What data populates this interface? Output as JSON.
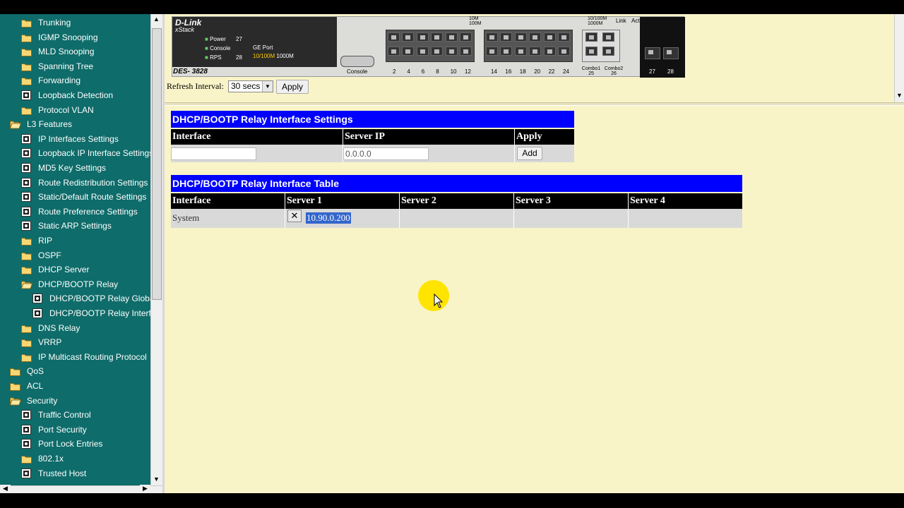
{
  "nav": {
    "items": [
      {
        "label": "Trunking",
        "icon": "folder",
        "indent": 1
      },
      {
        "label": "IGMP Snooping",
        "icon": "folder",
        "indent": 1
      },
      {
        "label": "MLD Snooping",
        "icon": "folder",
        "indent": 1
      },
      {
        "label": "Spanning Tree",
        "icon": "folder",
        "indent": 1
      },
      {
        "label": "Forwarding",
        "icon": "folder",
        "indent": 1
      },
      {
        "label": "Loopback Detection",
        "icon": "page",
        "indent": 1
      },
      {
        "label": "Protocol VLAN",
        "icon": "folder",
        "indent": 1
      },
      {
        "label": "L3 Features",
        "icon": "folder-open",
        "indent": 0
      },
      {
        "label": "IP Interfaces Settings",
        "icon": "page",
        "indent": 1
      },
      {
        "label": "Loopback IP Interface Settings",
        "icon": "page",
        "indent": 1
      },
      {
        "label": "MD5 Key Settings",
        "icon": "page",
        "indent": 1
      },
      {
        "label": "Route Redistribution Settings",
        "icon": "page",
        "indent": 1
      },
      {
        "label": "Static/Default Route Settings",
        "icon": "page",
        "indent": 1
      },
      {
        "label": "Route Preference Settings",
        "icon": "page",
        "indent": 1
      },
      {
        "label": "Static ARP Settings",
        "icon": "page",
        "indent": 1
      },
      {
        "label": "RIP",
        "icon": "folder",
        "indent": 1
      },
      {
        "label": "OSPF",
        "icon": "folder",
        "indent": 1
      },
      {
        "label": "DHCP Server",
        "icon": "folder",
        "indent": 1
      },
      {
        "label": "DHCP/BOOTP Relay",
        "icon": "folder-open",
        "indent": 1
      },
      {
        "label": "DHCP/BOOTP Relay Globa",
        "icon": "page",
        "indent": 2
      },
      {
        "label": "DHCP/BOOTP Relay Interfa",
        "icon": "page",
        "indent": 2
      },
      {
        "label": "DNS Relay",
        "icon": "folder",
        "indent": 1
      },
      {
        "label": "VRRP",
        "icon": "folder",
        "indent": 1
      },
      {
        "label": "IP Multicast Routing Protocol",
        "icon": "folder",
        "indent": 1
      },
      {
        "label": "QoS",
        "icon": "folder",
        "indent": 0
      },
      {
        "label": "ACL",
        "icon": "folder",
        "indent": 0
      },
      {
        "label": "Security",
        "icon": "folder-open",
        "indent": 0
      },
      {
        "label": "Traffic Control",
        "icon": "page",
        "indent": 1
      },
      {
        "label": "Port Security",
        "icon": "page",
        "indent": 1
      },
      {
        "label": "Port Lock Entries",
        "icon": "page",
        "indent": 1
      },
      {
        "label": "802.1x",
        "icon": "folder",
        "indent": 1
      },
      {
        "label": "Trusted Host",
        "icon": "page",
        "indent": 1
      }
    ]
  },
  "device": {
    "brand": "D-Link",
    "series": "xStack",
    "model": "DES- 3828",
    "leds": {
      "power": "Power",
      "console": "Console",
      "rps": "RPS",
      "p27": "27",
      "p28": "28",
      "ge_port": "GE Port",
      "speed1": "10/100M",
      "speed2": "1000M"
    },
    "top_legend": {
      "speed_a": "10M",
      "speed_b": "100M",
      "combo_a": "10/100M",
      "combo_b": "1000M",
      "link": "Link",
      "act": "Act"
    },
    "console_label": "Console",
    "port_numbers": [
      "2",
      "4",
      "6",
      "8",
      "10",
      "12",
      "14",
      "16",
      "18",
      "20",
      "22",
      "24"
    ],
    "combo_labels": [
      "Combo1",
      "Combo2"
    ],
    "combo_numbers": [
      "25",
      "26"
    ],
    "sfp_numbers": [
      "27",
      "28"
    ]
  },
  "refresh": {
    "label": "Refresh Interval:",
    "value": "30 secs",
    "apply_label": "Apply"
  },
  "settings_table": {
    "title": "DHCP/BOOTP Relay Interface Settings",
    "headers": [
      "Interface",
      "Server IP",
      "Apply"
    ],
    "interface_value": "",
    "server_ip_value": "0.0.0.0",
    "add_label": "Add"
  },
  "relay_table": {
    "title": "DHCP/BOOTP Relay Interface Table",
    "headers": [
      "Interface",
      "Server 1",
      "Server 2",
      "Server 3",
      "Server 4"
    ],
    "rows": [
      {
        "interface": "System",
        "server1": "10.90.0.200",
        "server2": "",
        "server3": "",
        "server4": ""
      }
    ]
  },
  "colors": {
    "nav_bg": "#0e6c6a",
    "page_bg": "#f8f4c8",
    "title_bar": "#0000ff",
    "header_bar": "#000000",
    "cell_bg": "#d9d9d9",
    "highlight": "#3366cc"
  }
}
